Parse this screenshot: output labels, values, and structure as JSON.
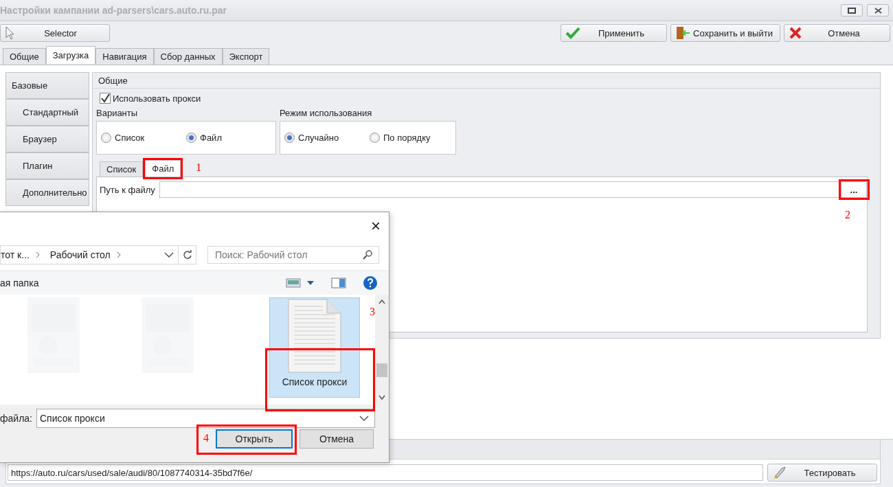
{
  "window": {
    "title": "Настройки кампании ad-parsers\\cars.auto.ru.par"
  },
  "toolbar": {
    "selector": "Selector",
    "actions": [
      {
        "kind": "apply",
        "label": "Применить"
      },
      {
        "kind": "save_exit",
        "label": "Сохранить и выйти"
      },
      {
        "kind": "cancel",
        "label": "Отмена"
      }
    ]
  },
  "tabs": [
    {
      "label": "Общие",
      "selected": false
    },
    {
      "label": "Загрузка",
      "selected": true
    },
    {
      "label": "Навигация",
      "selected": false
    },
    {
      "label": "Сбор данных",
      "selected": false
    },
    {
      "label": "Экспорт",
      "selected": false
    }
  ],
  "sidebar": {
    "header": "Базовые",
    "items": [
      "Стандартный",
      "Браузер",
      "Плагин",
      "Дополнительно"
    ]
  },
  "group": {
    "title": "Общие",
    "use_proxy": {
      "label": "Использовать прокси",
      "checked": true
    },
    "option_groups": [
      {
        "title": "Варианты",
        "options": [
          {
            "label": "Список",
            "selected": false
          },
          {
            "label": "Файл",
            "selected": true
          }
        ]
      },
      {
        "title": "Режим использования",
        "options": [
          {
            "label": "Случайно",
            "selected": true
          },
          {
            "label": "По порядку",
            "selected": false
          }
        ]
      }
    ],
    "subtabs": [
      {
        "label": "Список",
        "selected": false
      },
      {
        "label": "Файл",
        "selected": true,
        "annotation": "1"
      }
    ],
    "path": {
      "label": "Путь к файлу",
      "browse": "...",
      "annotation": "2"
    }
  },
  "test": {
    "url": "https://auto.ru/cars/used/sale/audi/80/1087740314-35bd7f6e/",
    "button": "Тестировать"
  },
  "dialog": {
    "close": "×",
    "breadcrumb": [
      "тот к...",
      "Рабочий стол"
    ],
    "search_placeholder": "Поиск: Рабочий стол",
    "new_folder": "ая папка",
    "files": [
      {
        "kind": "picture"
      },
      {
        "kind": "picture"
      },
      {
        "kind": "document",
        "name": "Список прокси",
        "selected": true,
        "annotation": "3"
      }
    ],
    "filename_label": "файла:",
    "filename": "Список прокси",
    "buttons": [
      {
        "label": "Открыть",
        "default": true,
        "annotation": "4"
      },
      {
        "label": "Отмена",
        "default": false
      }
    ]
  }
}
